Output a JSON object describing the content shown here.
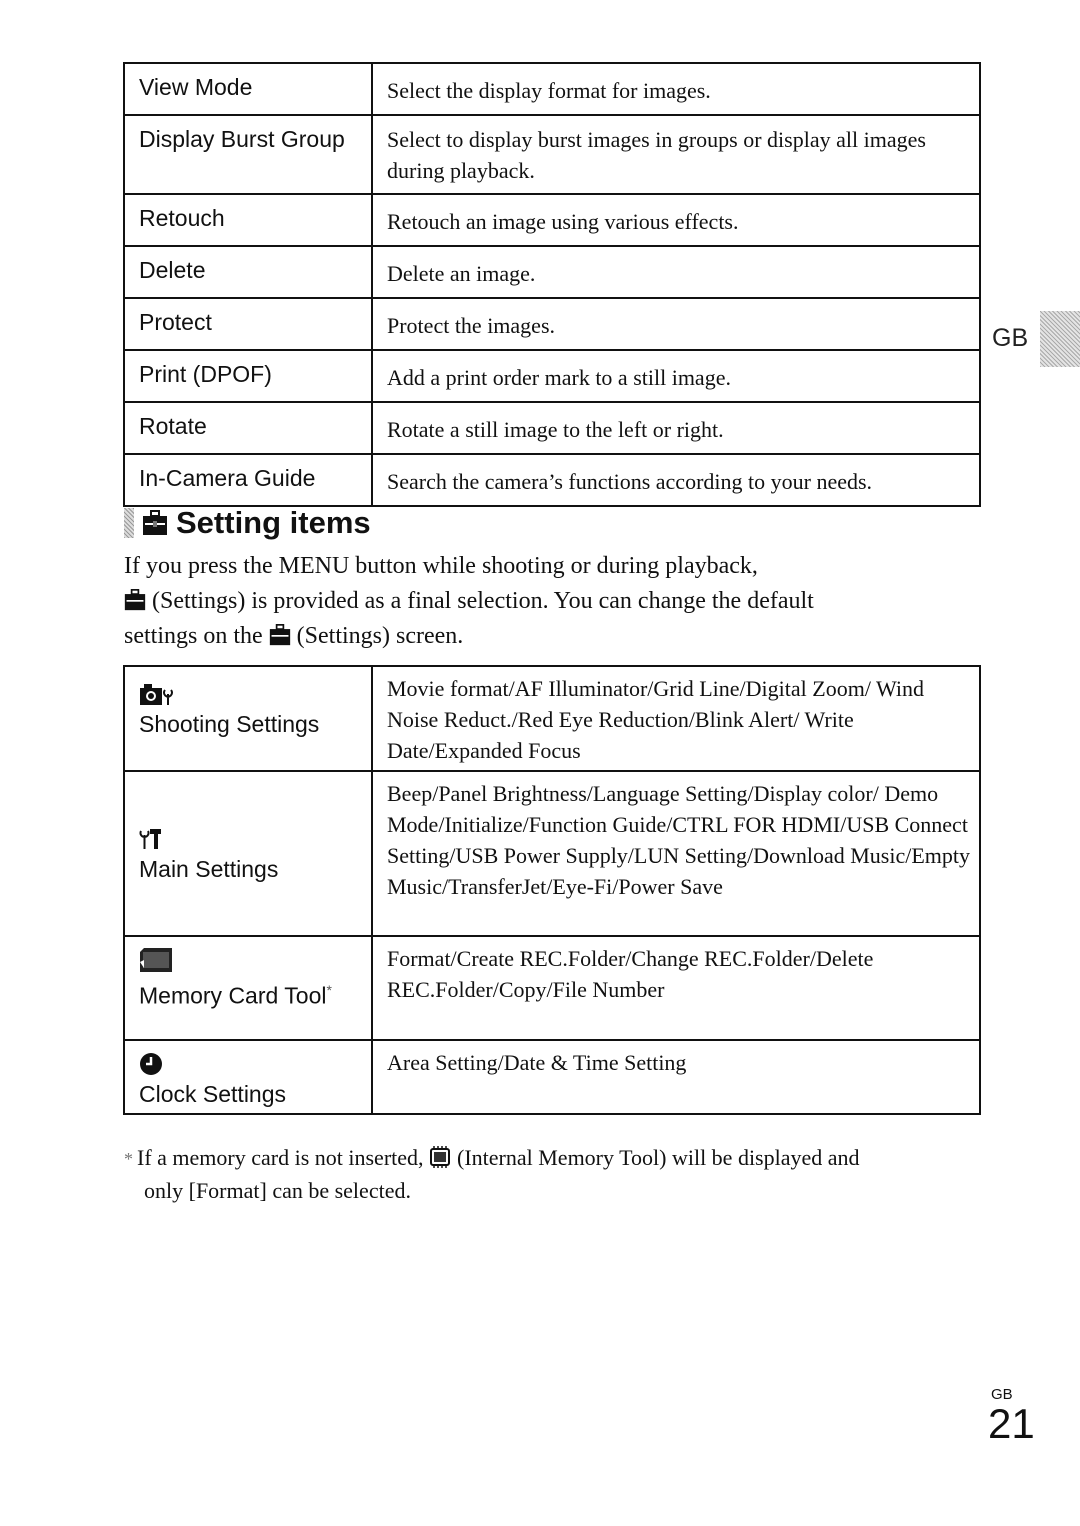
{
  "playback_table": {
    "rows": [
      {
        "item": "View Mode",
        "description": "Select the display format for images."
      },
      {
        "item": "Display Burst Group",
        "description": "Select to display burst images in groups or display all images during playback."
      },
      {
        "item": "Retouch",
        "description": "Retouch an image using various effects."
      },
      {
        "item": "Delete",
        "description": "Delete an image."
      },
      {
        "item": "Protect",
        "description": "Protect the images."
      },
      {
        "item": "Print (DPOF)",
        "description": "Add a print order mark to a still image."
      },
      {
        "item": "Rotate",
        "description": "Rotate a still image to the left or right."
      },
      {
        "item": "In-Camera Guide",
        "description": "Search the camera’s functions according to your needs."
      }
    ]
  },
  "section": {
    "icon": "settings-toolbox-icon",
    "title": "Setting items",
    "intro_line1": "If you press the MENU button while shooting or during playback,",
    "intro_line2": "(Settings) is provided as a final selection. You can change the default",
    "intro_line3a": "settings on the",
    "intro_line3b": "(Settings) screen."
  },
  "settings_table": {
    "rows": [
      {
        "icon": "camera-wrench-icon",
        "item": "Shooting Settings",
        "description": "Movie format/AF Illuminator/Grid Line/Digital Zoom/ Wind Noise Reduct./Red Eye Reduction/Blink Alert/ Write Date/Expanded Focus"
      },
      {
        "icon": "tools-icon",
        "item": "Main Settings",
        "description": "Beep/Panel Brightness/Language Setting/Display color/ Demo Mode/Initialize/Function Guide/CTRL FOR HDMI/USB Connect Setting/USB Power Supply/LUN Setting/Download Music/Empty Music/TransferJet/Eye-Fi/Power Save"
      },
      {
        "icon": "memory-card-icon",
        "item": "Memory Card Tool",
        "marker": "*",
        "description": "Format/Create REC.Folder/Change REC.Folder/Delete REC.Folder/Copy/File Number"
      },
      {
        "icon": "clock-icon",
        "item": "Clock Settings",
        "description": "Area Setting/Date & Time Setting"
      }
    ]
  },
  "footnote": {
    "marker": "*",
    "text_a": "If a memory card is not inserted,",
    "icon": "internal-memory-icon",
    "text_b": "(Internal Memory Tool) will be displayed and",
    "line2": "only [Format] can be selected."
  },
  "side_tab": {
    "label": "GB"
  },
  "page": {
    "lang": "GB",
    "number": "21"
  }
}
